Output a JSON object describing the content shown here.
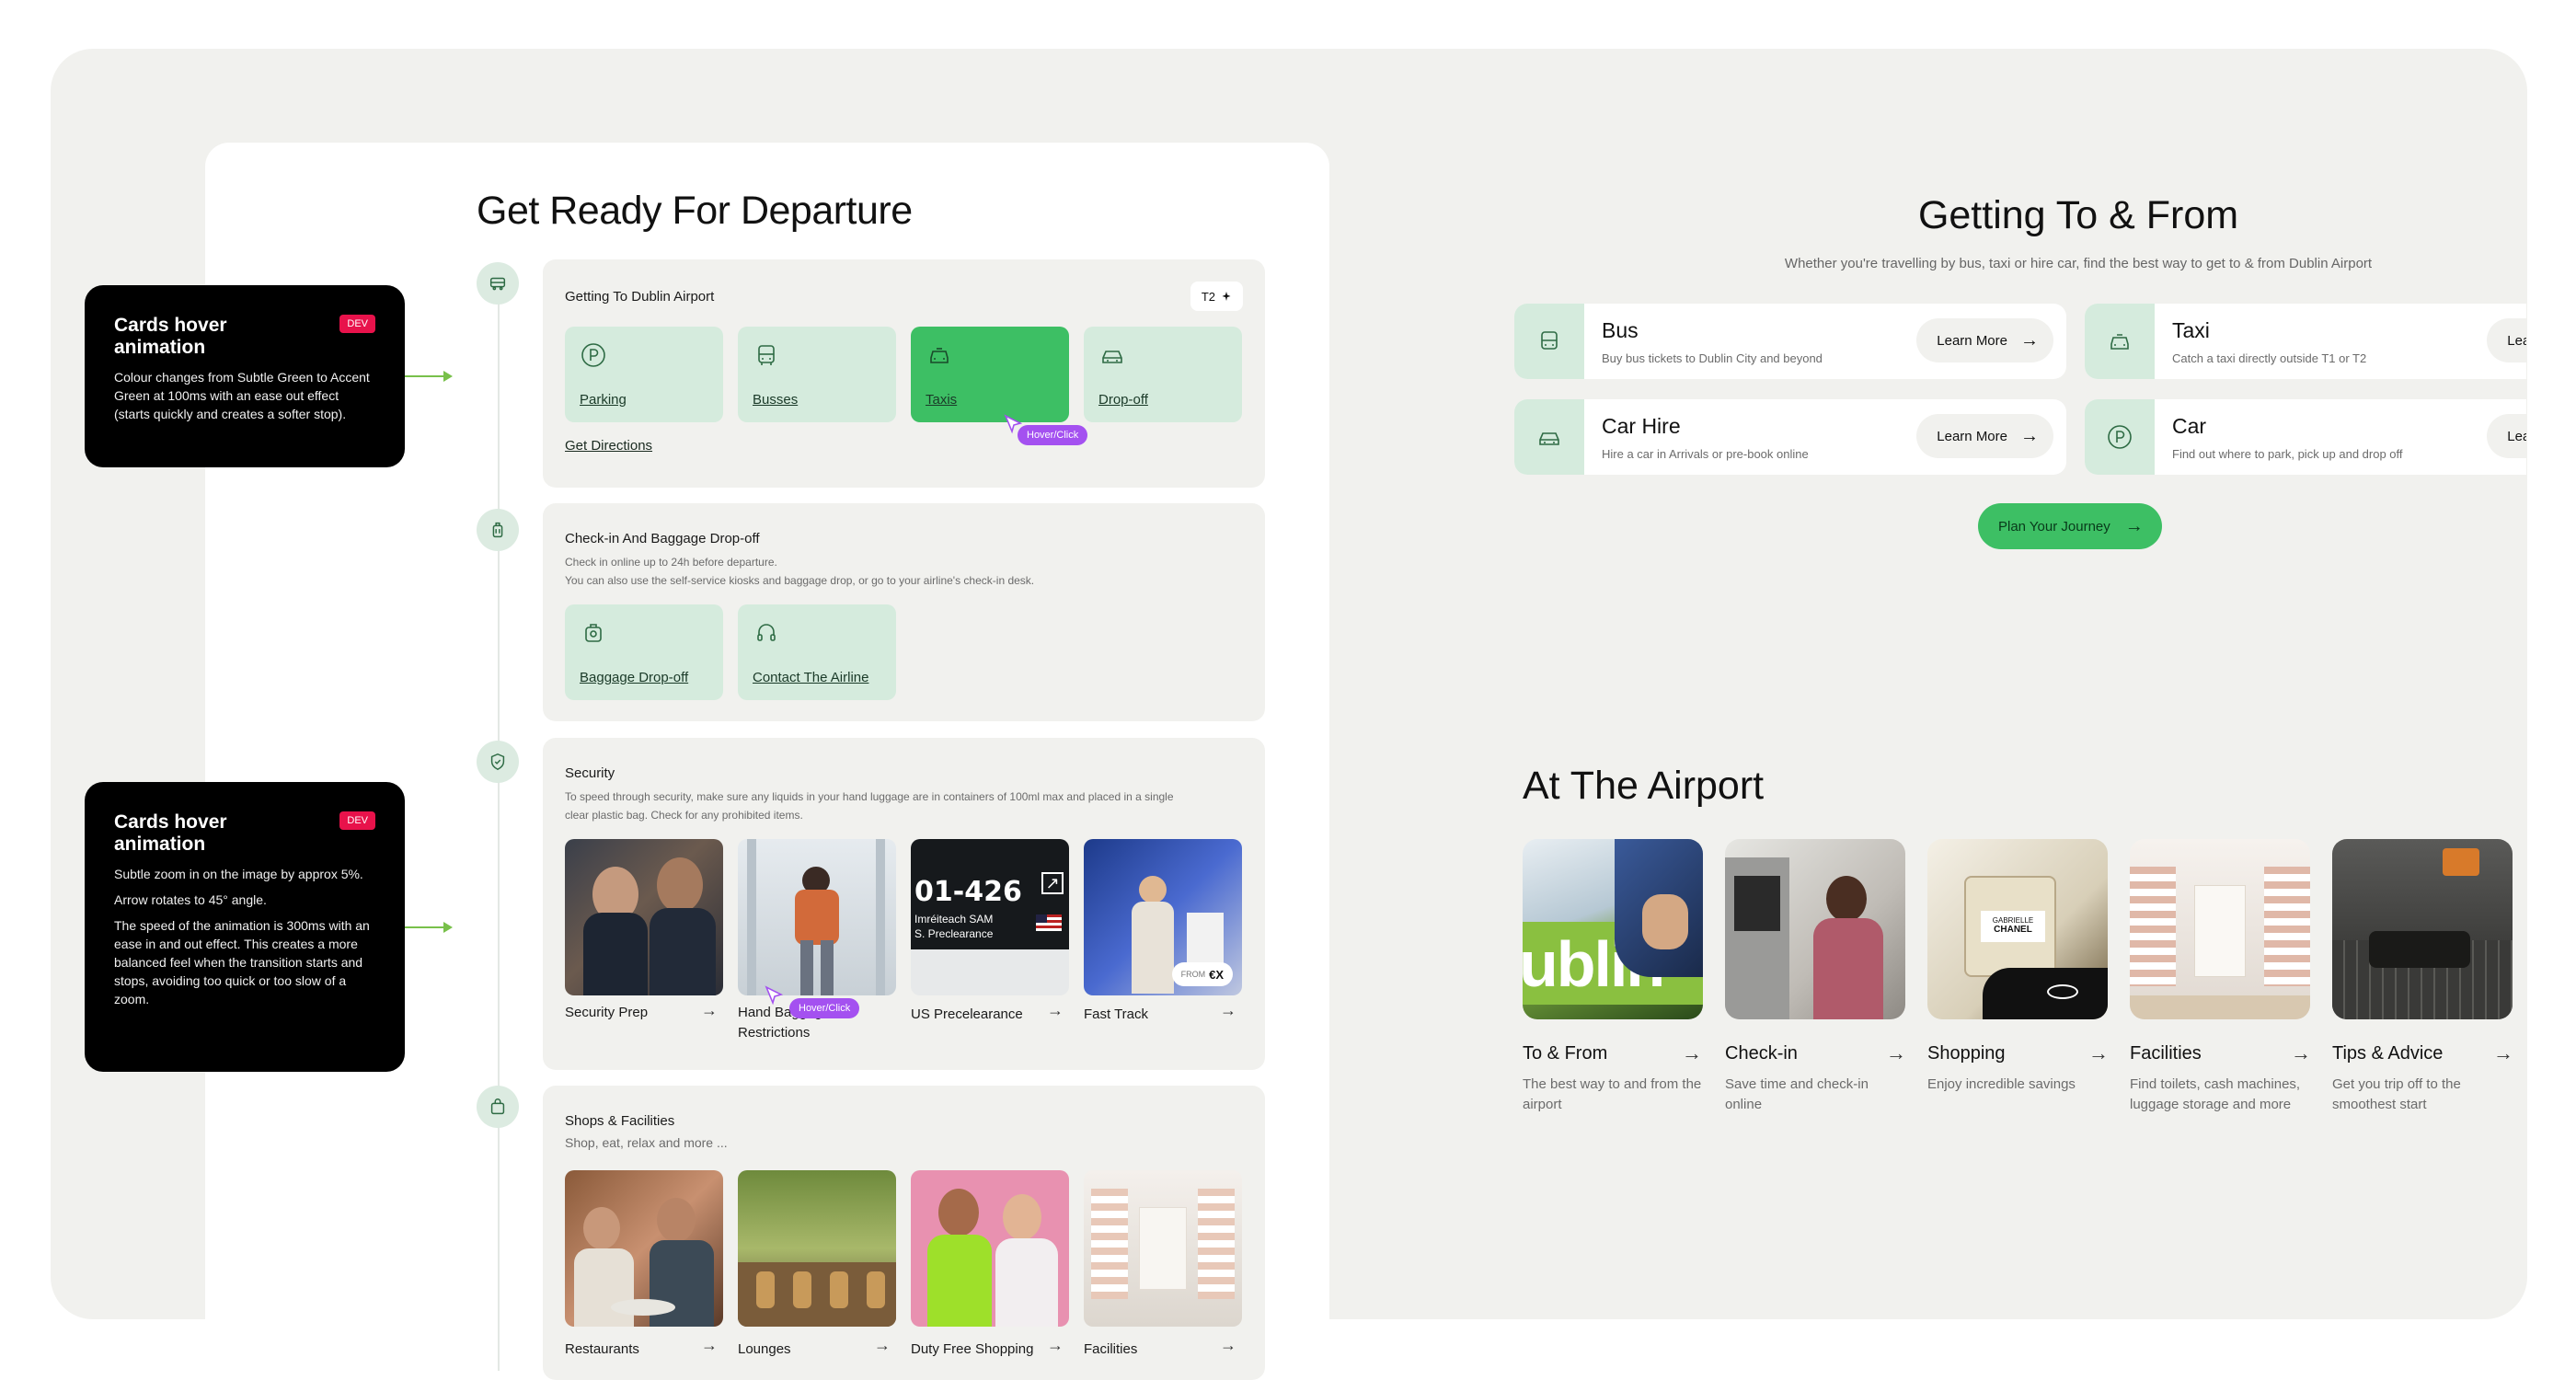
{
  "departure": {
    "title": "Get Ready For Departure",
    "getting_to": {
      "title": "Getting To Dublin Airport",
      "terminal_badge": "T2",
      "tiles": [
        {
          "label": "Parking",
          "icon": "parking-icon"
        },
        {
          "label": "Busses",
          "icon": "bus-icon"
        },
        {
          "label": "Taxis",
          "icon": "taxi-icon",
          "active": true
        },
        {
          "label": "Drop-off",
          "icon": "car-icon"
        }
      ],
      "directions_link": "Get Directions",
      "hover_tag": "Hover/Click"
    },
    "checkin": {
      "title": "Check-in And Baggage Drop-off",
      "desc_line1": "Check in online up to 24h before departure.",
      "desc_line2": "You can also use the self-service kiosks and baggage drop, or go to your airline's check-in desk.",
      "tiles": [
        {
          "label": "Baggage Drop-off",
          "icon": "luggage-icon"
        },
        {
          "label": "Contact The Airline",
          "icon": "headset-icon"
        }
      ]
    },
    "security": {
      "title": "Security",
      "desc": "To speed through security, make sure any liquids in your hand luggage are in containers of 100ml max and placed in a single clear plastic bag. Check for any prohibited items.",
      "cards": [
        {
          "label": "Security Prep"
        },
        {
          "label_line1": "Hand Baggage",
          "label_line2": "Restrictions"
        },
        {
          "label": "US Precelearance"
        },
        {
          "label": "Fast Track",
          "price_prefix": "FROM",
          "price": "€X"
        }
      ],
      "hover_tag": "Hover/Click",
      "sign_text_1": "01-426",
      "sign_text_2": "Imréiteach SAM",
      "sign_text_3": "S. Preclearance"
    },
    "shops": {
      "title": "Shops & Facilities",
      "desc": "Shop, eat, relax and more ...",
      "cards": [
        {
          "label": "Restaurants"
        },
        {
          "label": "Lounges"
        },
        {
          "label": "Duty Free Shopping"
        },
        {
          "label": "Facilities"
        }
      ]
    }
  },
  "annotations": [
    {
      "title": "Cards hover animation",
      "badge": "DEV",
      "paragraphs": [
        "Colour changes from Subtle Green to Accent Green at 100ms with an ease out effect (starts quickly and creates a softer stop)."
      ]
    },
    {
      "title": "Cards hover animation",
      "badge": "DEV",
      "paragraphs": [
        "Subtle zoom in on the image by approx 5%.",
        "Arrow rotates to 45° angle.",
        "The speed of the animation is 300ms with an ease in and out effect. This creates a more balanced feel when the transition starts and stops, avoiding too quick or too slow of a zoom."
      ]
    }
  ],
  "getting_to_from": {
    "title": "Getting To & From",
    "subtitle": "Whether you're travelling by bus, taxi or hire car, find the best way to get to & from Dublin Airport",
    "cards": [
      {
        "title": "Bus",
        "sub": "Buy bus tickets to Dublin City and beyond",
        "button": "Learn More",
        "icon": "bus-icon"
      },
      {
        "title": "Taxi",
        "sub": "Catch a taxi directly outside T1 or T2",
        "button": "Learn More",
        "icon": "taxi-icon"
      },
      {
        "title": "Car Hire",
        "sub": "Hire a car in Arrivals or pre-book online",
        "button": "Learn More",
        "icon": "car-icon"
      },
      {
        "title": "Car",
        "sub": "Find out where to park, pick up and drop off",
        "button": "Learn More",
        "icon": "parking-icon"
      }
    ],
    "plan_button": "Plan Your Journey"
  },
  "at_the_airport": {
    "title": "At The Airport",
    "cards": [
      {
        "title": "To & From",
        "desc": "The best way to and from the airport"
      },
      {
        "title": "Check-in",
        "desc": "Save time and check-in online"
      },
      {
        "title": "Shopping",
        "desc": "Enjoy incredible savings",
        "img_text_1": "GABRIELLE",
        "img_text_2": "CHANEL"
      },
      {
        "title": "Facilities",
        "desc": "Find toilets, cash machines, luggage storage and more"
      },
      {
        "title": "Tips & Advice",
        "desc": "Get you trip off to the smoothest start"
      }
    ],
    "bus_sign": "ublin"
  },
  "colors": {
    "accent_green": "#3dbf64",
    "subtle_green": "#d5ebdd",
    "hover_purple": "#a451f0",
    "dev_red": "#e8124b"
  }
}
